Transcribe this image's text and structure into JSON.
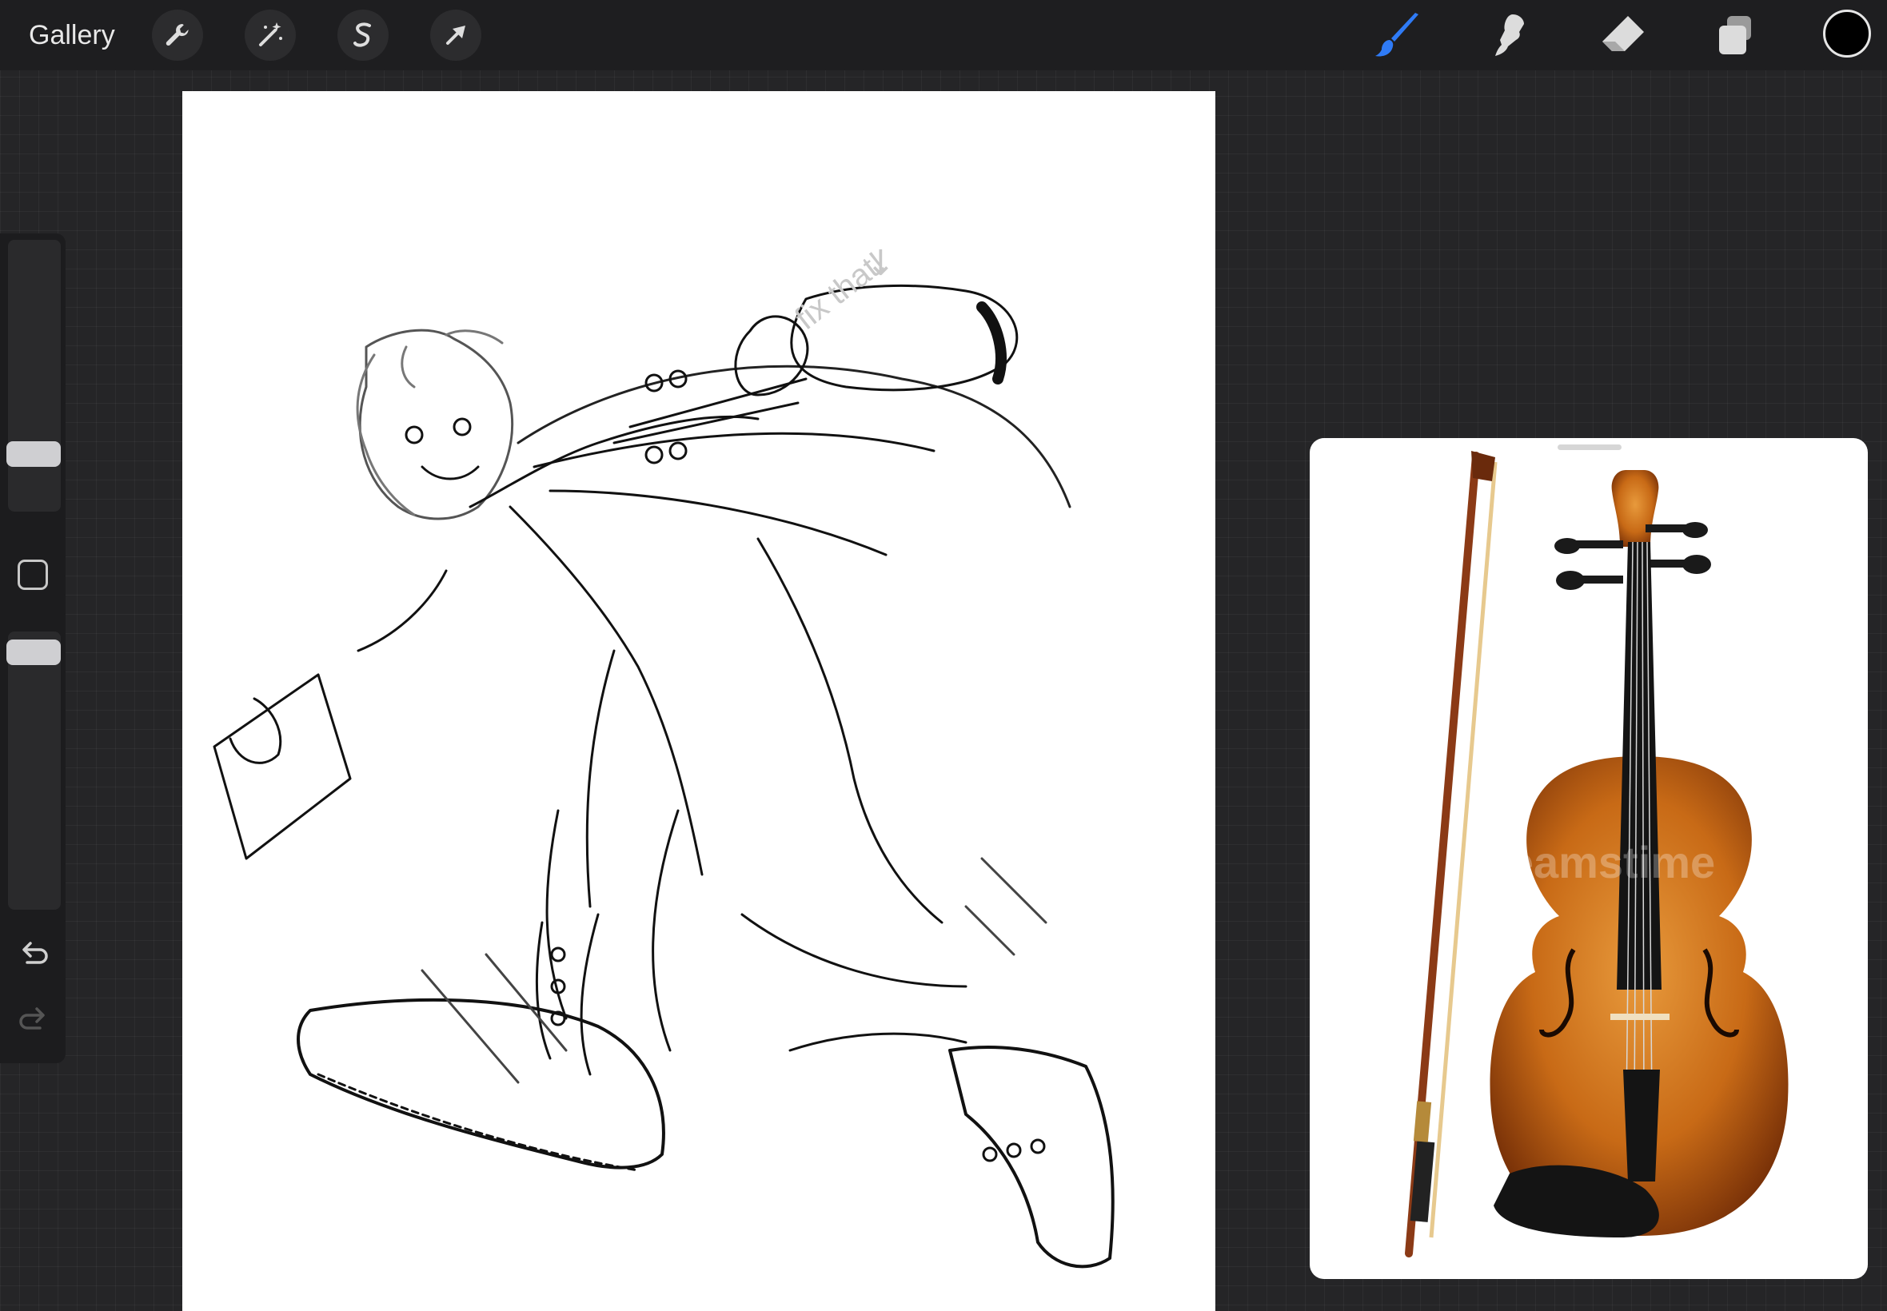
{
  "topbar": {
    "gallery_label": "Gallery",
    "left_tools": [
      "wrench-icon",
      "magic-wand-icon",
      "selection-icon",
      "transform-arrow-icon"
    ],
    "right_tools": [
      "brush-icon",
      "smudge-icon",
      "eraser-icon",
      "layers-icon"
    ],
    "active_tool": "brush-icon",
    "current_color": "#000000",
    "accent_color": "#2f7bf6"
  },
  "sidebar": {
    "controls": [
      "brush-size-slider",
      "modify-button",
      "opacity-slider",
      "undo-icon",
      "redo-icon"
    ]
  },
  "canvas": {
    "note_text": "fix that!",
    "note_arrow": "↓"
  },
  "reference": {
    "watermark": "dreamstime",
    "subject": "violin-and-bow"
  }
}
